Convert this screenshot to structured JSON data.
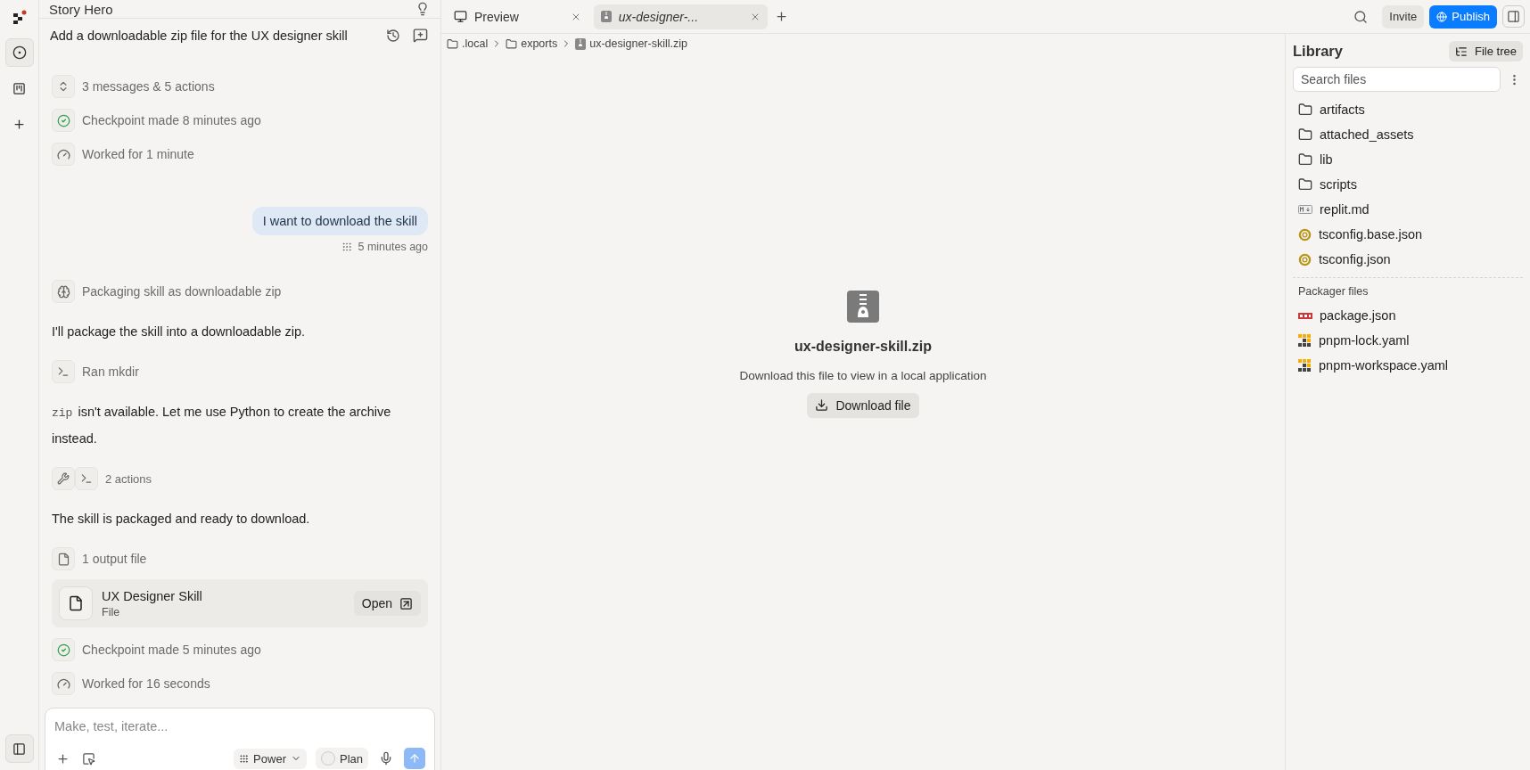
{
  "rail": [
    {
      "kind": "agent",
      "selected": true
    },
    {
      "kind": "board",
      "selected": false
    },
    {
      "kind": "add",
      "selected": false
    }
  ],
  "project": {
    "title": "Story Hero"
  },
  "chat": {
    "title": "Add a downloadable zip file for the UX designer skill",
    "feed": [
      {
        "kind": "summary",
        "text": "3 messages & 5 actions"
      },
      {
        "kind": "checkpoint",
        "text": "Checkpoint made 8 minutes ago"
      },
      {
        "kind": "timer",
        "text": "Worked for 1 minute"
      },
      {
        "kind": "user",
        "text": "I want to download the skill"
      },
      {
        "kind": "timestamp",
        "text": "5 minutes ago"
      },
      {
        "kind": "thought",
        "text": "Packaging skill as downloadable zip"
      },
      {
        "kind": "paragraph",
        "text": "I'll package the skill into a downloadable zip."
      },
      {
        "kind": "command",
        "text": "Ran mkdir"
      },
      {
        "kind": "paragraph",
        "code": "zip",
        "text": "isn't available. Let me use Python to create the archive instead."
      },
      {
        "kind": "actions",
        "text": "2 actions"
      },
      {
        "kind": "paragraph",
        "text": "The skill is packaged and ready to download."
      },
      {
        "kind": "output",
        "text": "1 output file"
      },
      {
        "kind": "file",
        "text": "UX Designer Skill",
        "subtitle": "File",
        "action": "Open"
      },
      {
        "kind": "checkpoint",
        "text": "Checkpoint made 5 minutes ago"
      },
      {
        "kind": "timer",
        "text": "Worked for 16 seconds"
      }
    ],
    "composer": {
      "placeholder": "Make, test, iterate...",
      "mode": "Power",
      "plan": {
        "label": "Plan",
        "checked": false
      }
    }
  },
  "tabs": [
    {
      "label": "Preview",
      "kind": "preview",
      "selected": false
    },
    {
      "label": "ux-designer-...",
      "kind": "zip",
      "selected": true
    }
  ],
  "top_actions": {
    "invite": "Invite",
    "publish": "Publish"
  },
  "breadcrumb": [
    {
      "label": ".local",
      "kind": "folder"
    },
    {
      "label": "exports",
      "kind": "folder"
    },
    {
      "label": "ux-designer-skill.zip",
      "kind": "zip"
    }
  ],
  "viewer": {
    "filename": "ux-designer-skill.zip",
    "message": "Download this file to view in a local application",
    "button": "Download file"
  },
  "library": {
    "title": "Library",
    "view_button": "File tree",
    "search": {
      "placeholder": "Search files"
    },
    "files": [
      {
        "name": "artifacts",
        "kind": "folder"
      },
      {
        "name": "attached_assets",
        "kind": "folder"
      },
      {
        "name": "lib",
        "kind": "folder"
      },
      {
        "name": "scripts",
        "kind": "folder"
      },
      {
        "name": "replit.md",
        "kind": "markdown"
      },
      {
        "name": "tsconfig.base.json",
        "kind": "tsconfig"
      },
      {
        "name": "tsconfig.json",
        "kind": "tsconfig"
      }
    ],
    "packager_title": "Packager files",
    "packager_files": [
      {
        "name": "package.json",
        "kind": "npm"
      },
      {
        "name": "pnpm-lock.yaml",
        "kind": "pnpm"
      },
      {
        "name": "pnpm-workspace.yaml",
        "kind": "pnpm"
      }
    ]
  }
}
